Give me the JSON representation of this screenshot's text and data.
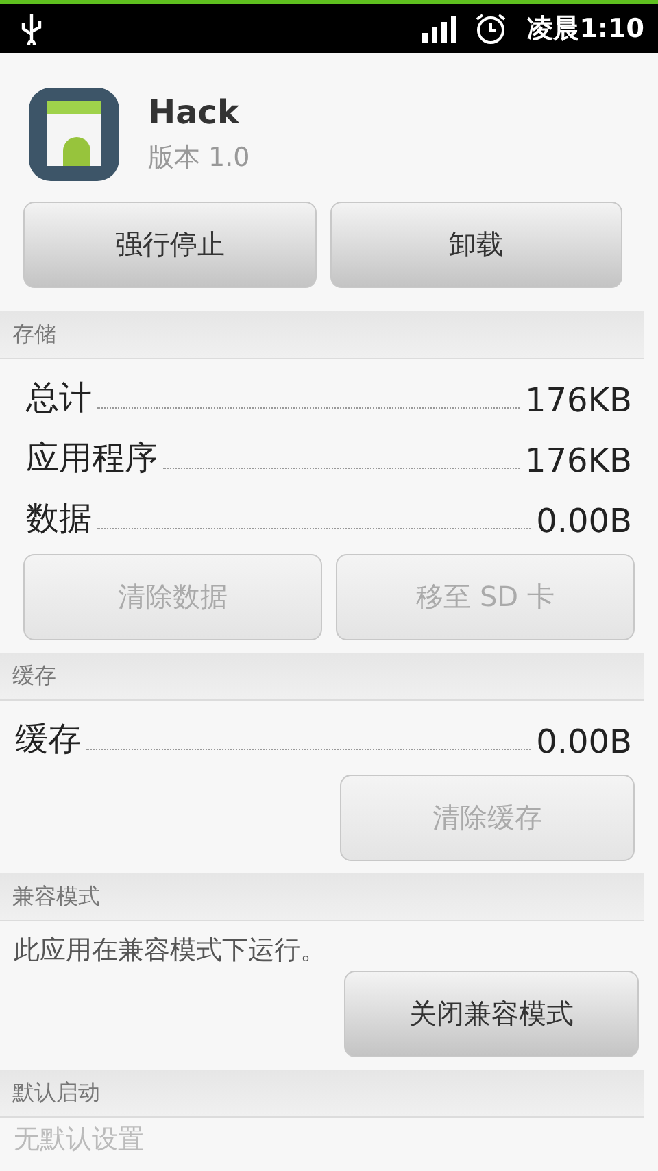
{
  "status_bar": {
    "time": "凌晨1:10"
  },
  "app": {
    "name": "Hack",
    "version": "版本 1.0"
  },
  "actions": [
    {
      "label": "强行停止",
      "disabled": false
    },
    {
      "label": "卸载",
      "disabled": false
    }
  ],
  "sections": [
    {
      "title": "存储",
      "rows": [
        {
          "label": "总计",
          "value": "176KB"
        },
        {
          "label": "应用程序",
          "value": "176KB"
        },
        {
          "label": "数据",
          "value": "0.00B"
        }
      ],
      "buttons": [
        {
          "label": "清除数据",
          "disabled": true
        },
        {
          "label": "移至 SD 卡",
          "disabled": true
        }
      ]
    },
    {
      "title": "缓存",
      "rows": [
        {
          "label": "缓存",
          "value": "0.00B"
        }
      ],
      "buttons": [
        {
          "label": "清除缓存",
          "disabled": true
        }
      ]
    },
    {
      "title": "兼容模式",
      "note": "此应用在兼容模式下运行。",
      "buttons": [
        {
          "label": "关闭兼容模式",
          "disabled": false
        }
      ]
    },
    {
      "title": "默认启动",
      "note": "无默认设置"
    }
  ]
}
